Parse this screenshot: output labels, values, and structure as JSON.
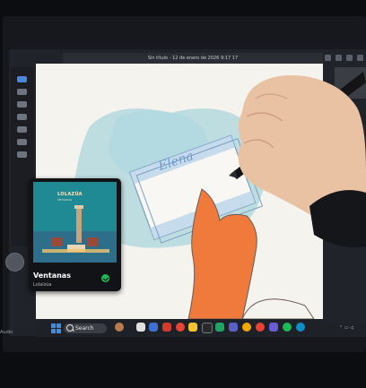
{
  "window": {
    "title": "Sin título - 12 de enero de 2026 9:17 17"
  },
  "now_playing": {
    "album_title": "LOLAZÚA",
    "album_subtitle": "Ventanas",
    "track_title": "Ventanas",
    "artist": "Lolalzúa"
  },
  "taskbar": {
    "search_placeholder": "Search"
  },
  "side_label": "Audio",
  "drawing": {
    "text": "Elena"
  },
  "colors": {
    "screen": "#20232a",
    "canvas": "#f5f3ee",
    "watercolor": "#8fcad6",
    "hand_drawn": "#f07a3c",
    "spotify_check": "#1db954",
    "windows_start": "#3b8ee6"
  },
  "icons": [
    "windows-start-icon",
    "search-icon",
    "check-icon",
    "stylus-icon"
  ]
}
